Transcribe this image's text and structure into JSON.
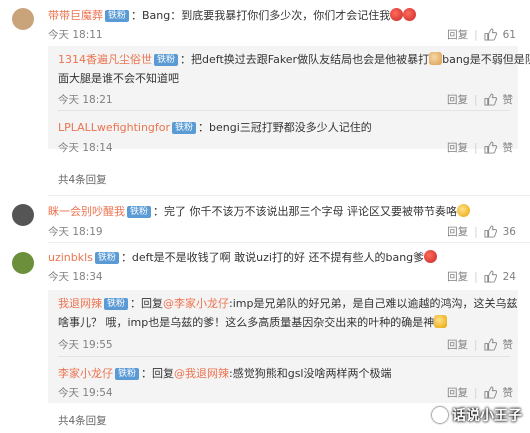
{
  "comments": [
    {
      "user": "带带巨魔葬",
      "badge": "铁粉",
      "text": "：Bang：到底要我暴打你们多少次，你们才会记住我",
      "time": "今天 18:11",
      "reply_label": "回复",
      "likes": "61",
      "avatar_color": "#c9a37a"
    },
    {
      "user": "眯一会别吵醒我",
      "badge": "铁粉",
      "text": "：完了 你千不该万不该说出那三个字母 评论区又要被带节奏咯",
      "time": "今天 18:19",
      "reply_label": "回复",
      "likes": "36",
      "avatar_color": "#555555"
    },
    {
      "user": "uzinbkls",
      "badge": "铁粉",
      "text": "：deft是不是收钱了啊  敢说uzi打的好  还不提有些人的bang爹",
      "time": "今天 18:34",
      "reply_label": "回复",
      "likes": "24",
      "avatar_color": "#6b8f3a"
    }
  ],
  "replies_1": [
    {
      "user": "1314香遍凡尘俗世",
      "badge": "铁粉",
      "text_line1": "：把deft换过去跟Faker做队友结局也会是他被暴打",
      "text_line1_tail": "bang是不弱但是队里",
      "text_line2": "面大腿是谁不会不知道吧",
      "time": "今天 18:21",
      "reply_label": "回复",
      "likes": "赞"
    },
    {
      "user": "LPLALLwefightingfor",
      "badge": "铁粉",
      "text": "：bengi三冠打野都没多少人记住的",
      "time": "今天 18:14",
      "reply_label": "回复",
      "likes": "赞"
    }
  ],
  "more_1": "共4条回复",
  "replies_3": [
    {
      "user": "我退网辣",
      "badge": "铁粉",
      "prefix": "：回复",
      "mention": "@李家小龙仔",
      "text_line1": ":imp是兄弟队的好兄弟，是自己难以逾越的鸿沟，这关乌兹",
      "text_line2": "啥事儿？ 哦，imp也是乌兹的爹！这么多高质量基因杂交出来的叶种的确是神",
      "time": "今天 19:55",
      "reply_label": "回复",
      "likes": "赞"
    },
    {
      "user": "李家小龙仔",
      "badge": "铁粉",
      "prefix": "：回复",
      "mention": "@我退网辣",
      "text": ":感觉狗熊和gsl没啥两样两个极端",
      "time": "今天 19:54",
      "reply_label": "回复",
      "likes": "赞"
    }
  ],
  "more_3": "共4条回复",
  "watermark": "话说小王子",
  "colors": {
    "username": "#eb7350",
    "badge": "#5b9bd5",
    "meta": "#808080",
    "reply_bg": "#f4f4f4"
  }
}
